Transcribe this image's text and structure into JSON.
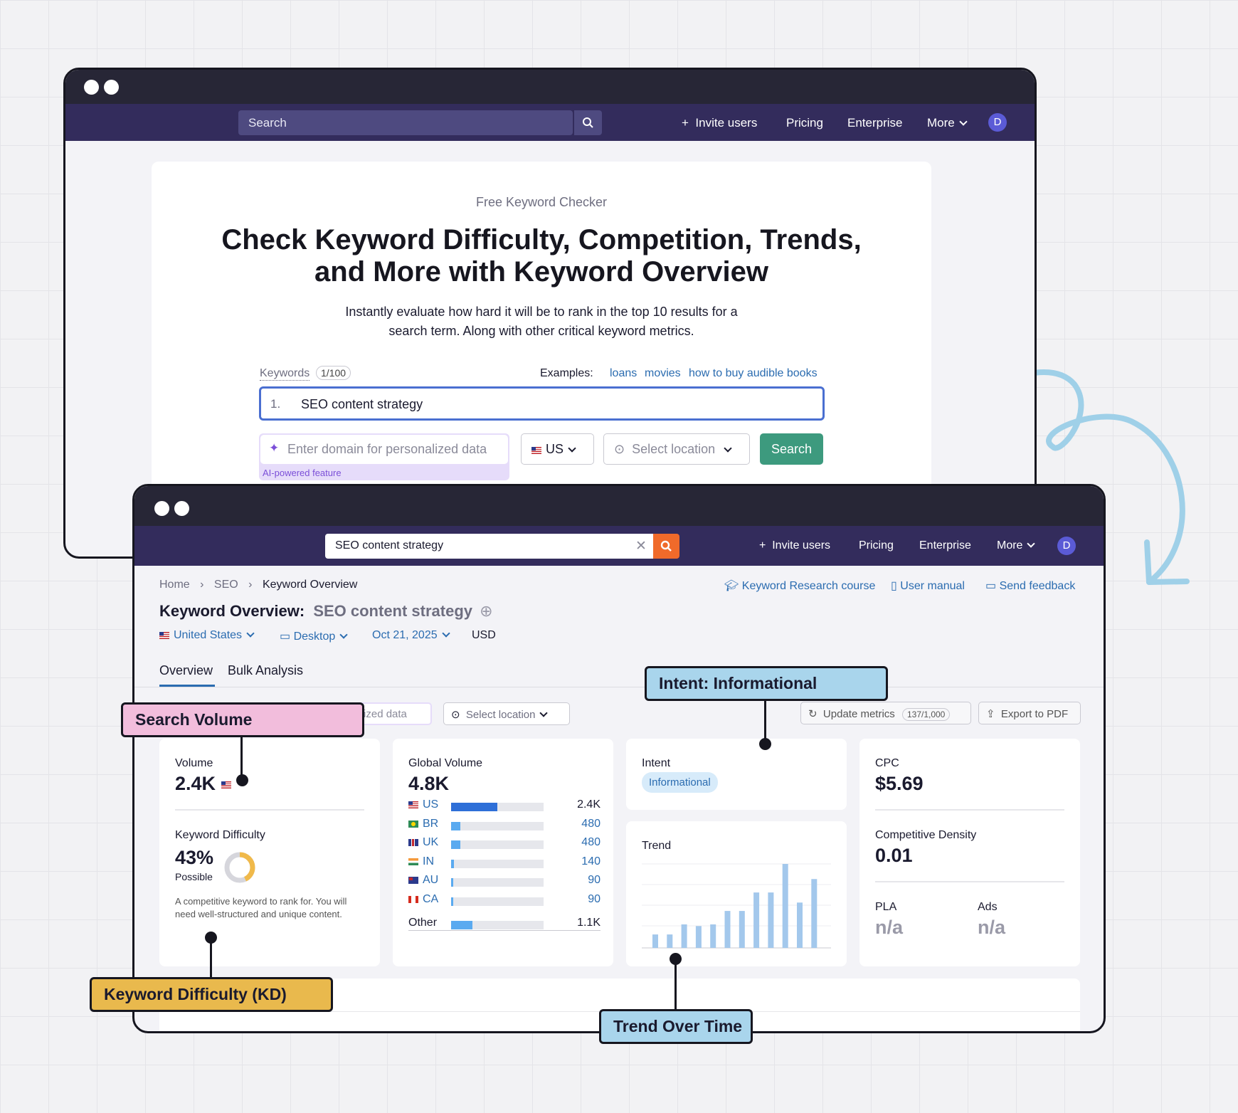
{
  "back_window": {
    "search_placeholder": "Search",
    "nav": {
      "invite": "Invite users",
      "pricing": "Pricing",
      "enterprise": "Enterprise",
      "more": "More",
      "avatar": "D"
    },
    "eyebrow": "Free Keyword Checker",
    "heading_line1": "Check Keyword Difficulty, Competition, Trends,",
    "heading_line2": "and More with Keyword Overview",
    "desc_line1": "Instantly evaluate how hard it will be to rank in the top 10 results for a",
    "desc_line2": "search term. Along with other critical keyword metrics.",
    "keywords_label": "Keywords",
    "keywords_count": "1/100",
    "examples_label": "Examples:",
    "examples": [
      "loans",
      "movies",
      "how to buy audible books"
    ],
    "keyword_index": "1.",
    "keyword_value": "SEO content strategy",
    "domain_placeholder": "Enter domain for personalized data",
    "ai_badge": "AI-powered feature",
    "country": "US",
    "location_placeholder": "Select location",
    "search_button": "Search"
  },
  "front_window": {
    "search_value": "SEO content strategy",
    "nav": {
      "invite": "Invite users",
      "pricing": "Pricing",
      "enterprise": "Enterprise",
      "more": "More",
      "avatar": "D"
    },
    "breadcrumb": [
      "Home",
      "SEO",
      "Keyword Overview"
    ],
    "links": {
      "course": "Keyword Research course",
      "manual": "User manual",
      "feedback": "Send feedback"
    },
    "title_prefix": "Keyword Overview:",
    "title_keyword": "SEO content strategy",
    "filters": {
      "country": "United States",
      "device": "Desktop",
      "date": "Oct 21, 2025",
      "currency": "USD"
    },
    "tabs": [
      "Overview",
      "Bulk Analysis"
    ],
    "domain_partial": "nalized data",
    "location_placeholder": "Select location",
    "update_metrics": "Update metrics",
    "update_count": "137/1,000",
    "export_pdf": "Export to PDF",
    "volume": {
      "label": "Volume",
      "value": "2.4K"
    },
    "kd": {
      "label": "Keyword Difficulty",
      "value": "43%",
      "percent": 43,
      "rating": "Possible",
      "note_line1": "A competitive keyword to rank for. You will",
      "note_line2": "need well-structured and unique content."
    },
    "global_volume": {
      "label": "Global Volume",
      "value": "4.8K",
      "rows": [
        {
          "code": "US",
          "value": "2.4K",
          "share": 0.5
        },
        {
          "code": "BR",
          "value": "480",
          "share": 0.1
        },
        {
          "code": "UK",
          "value": "480",
          "share": 0.1
        },
        {
          "code": "IN",
          "value": "140",
          "share": 0.03
        },
        {
          "code": "AU",
          "value": "90",
          "share": 0.02
        },
        {
          "code": "CA",
          "value": "90",
          "share": 0.02
        }
      ],
      "other": {
        "code": "Other",
        "value": "1.1K",
        "share": 0.23
      }
    },
    "intent": {
      "label": "Intent",
      "value": "Informational"
    },
    "trend": {
      "label": "Trend",
      "values": [
        0.16,
        0.16,
        0.28,
        0.26,
        0.28,
        0.44,
        0.44,
        0.66,
        0.66,
        1.0,
        0.54,
        0.82
      ]
    },
    "cpc": {
      "label": "CPC",
      "value": "$5.69"
    },
    "comp_density": {
      "label": "Competitive Density",
      "value": "0.01"
    },
    "pla": {
      "label": "PLA",
      "value": "n/a"
    },
    "ads": {
      "label": "Ads",
      "value": "n/a"
    }
  },
  "callouts": {
    "search_volume": "Search Volume",
    "intent": "Intent: Informational",
    "kd": "Keyword Difficulty (KD)",
    "trend": "Trend Over Time"
  },
  "colors": {
    "nav": "#332c5c",
    "titlebar": "#272636",
    "search_green": "#3d9a7e",
    "search_orange": "#f06a2a",
    "bar_blue": "#2e6fd8",
    "trend_bar": "#a3c8ec",
    "kd_ring": "#f0b94a",
    "arrow": "#9fd0e8"
  }
}
